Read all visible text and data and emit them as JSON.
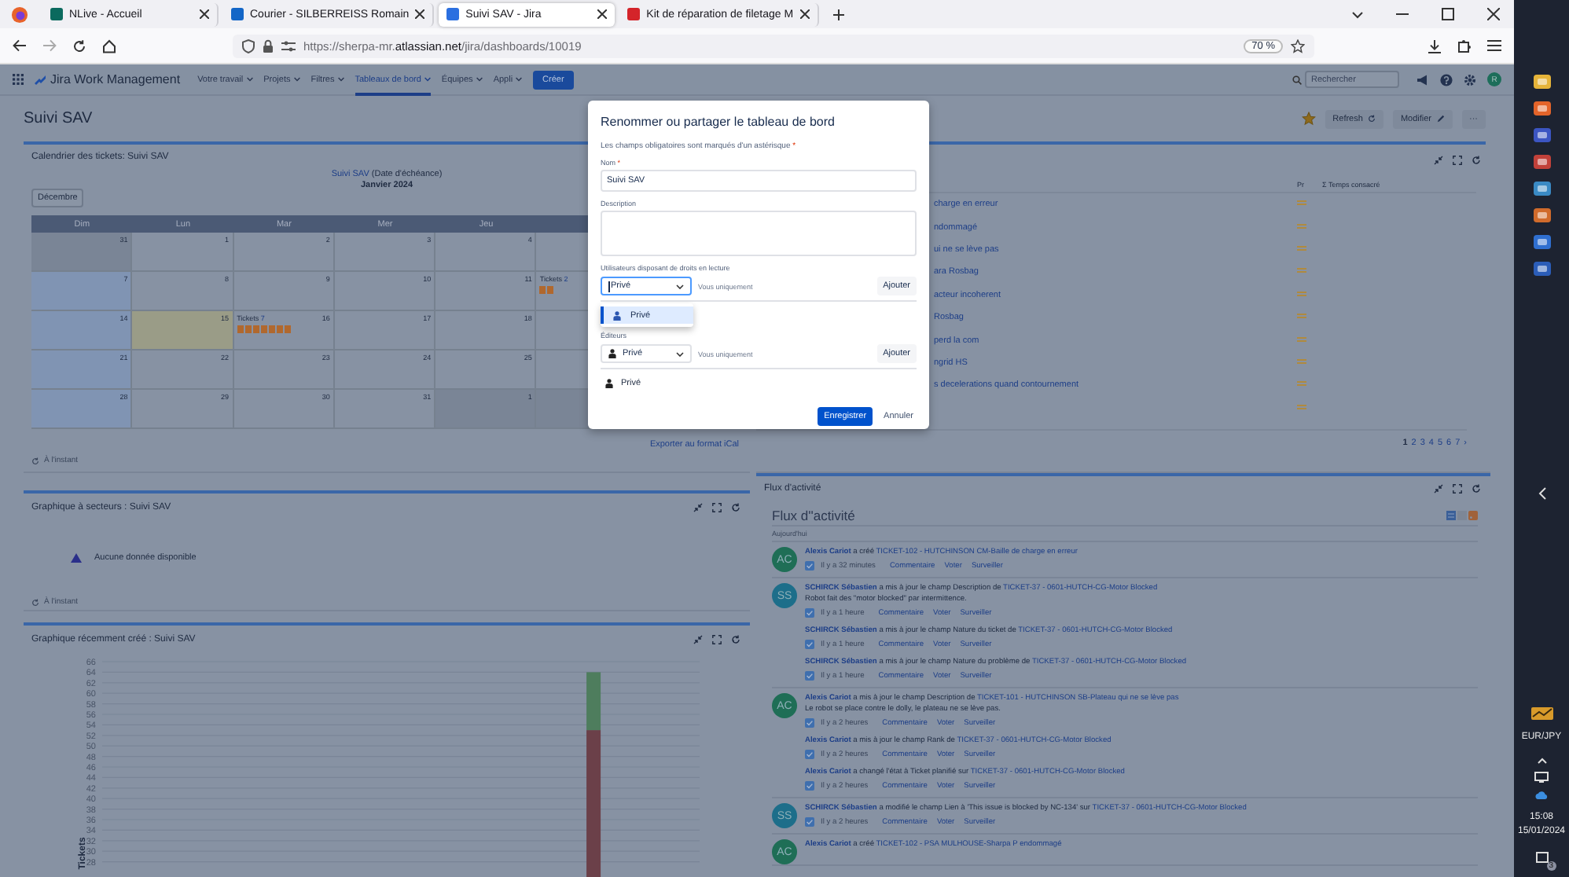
{
  "browser": {
    "tabs": [
      {
        "title": "NLive - Accueil",
        "kind": "nlive",
        "selected": false
      },
      {
        "title": "Courier - SILBERREISS Romain",
        "kind": "mail",
        "selected": false
      },
      {
        "title": "Suivi SAV - Jira",
        "kind": "jira",
        "selected": true
      },
      {
        "title": "Kit de réparation de filetage M",
        "kind": "rs",
        "selected": false
      }
    ],
    "url": "https://sherpa-mr.**atlassian.net**/jira/dashboards/10019",
    "zoom": "70 %"
  },
  "jira": {
    "product": "Jira Work Management",
    "nav": [
      {
        "label": "Votre travail",
        "selected": false
      },
      {
        "label": "Projets",
        "selected": false
      },
      {
        "label": "Filtres",
        "selected": false
      },
      {
        "label": "Tableaux de bord",
        "selected": true
      },
      {
        "label": "Équipes",
        "selected": false
      },
      {
        "label": "Appli",
        "selected": false
      }
    ],
    "create": "Créer",
    "search": {
      "placeholder": "Rechercher"
    },
    "avatar": "R"
  },
  "dashboard": {
    "title": "Suivi SAV",
    "starred": true,
    "refresh": "Refresh",
    "edit": "Modifier",
    "more": "···"
  },
  "calendar": {
    "title": "Calendrier des tickets: Suivi SAV",
    "filter": "Suivi SAV",
    "field": "(Date d'échéance)",
    "month": "Janvier 2024",
    "previous": "Décembre",
    "weekdays": [
      "Dim",
      "Lun",
      "Mar",
      "Mer",
      "Jeu"
    ],
    "weeks": [
      {
        "days": [
          {
            "day": "31",
            "kind": "other"
          },
          {
            "day": "1",
            "kind": "normal"
          },
          {
            "day": "2",
            "kind": "normal"
          },
          {
            "day": "3",
            "kind": "normal"
          },
          {
            "day": "4",
            "kind": "normal"
          },
          {
            "kind": "normal"
          }
        ]
      },
      {
        "days": [
          {
            "day": "7",
            "kind": "weekend"
          },
          {
            "day": "8",
            "kind": "normal"
          },
          {
            "day": "9",
            "kind": "normal"
          },
          {
            "day": "10",
            "kind": "normal"
          },
          {
            "day": "11",
            "kind": "normal"
          },
          {
            "kind": "normal",
            "tickets": {
              "label": "Tickets",
              "count": "2"
            }
          }
        ]
      },
      {
        "days": [
          {
            "day": "14",
            "kind": "weekend"
          },
          {
            "day": "15",
            "kind": "today"
          },
          {
            "day": "16",
            "kind": "normal",
            "tickets": {
              "label": "Tickets",
              "count": "7"
            }
          },
          {
            "day": "17",
            "kind": "normal"
          },
          {
            "day": "18",
            "kind": "normal"
          },
          {
            "kind": "normal"
          }
        ]
      },
      {
        "days": [
          {
            "day": "21",
            "kind": "weekend"
          },
          {
            "day": "22",
            "kind": "normal"
          },
          {
            "day": "23",
            "kind": "normal"
          },
          {
            "day": "24",
            "kind": "normal"
          },
          {
            "day": "25",
            "kind": "normal"
          },
          {
            "kind": "normal"
          }
        ]
      },
      {
        "days": [
          {
            "day": "28",
            "kind": "weekend"
          },
          {
            "day": "29",
            "kind": "normal"
          },
          {
            "day": "30",
            "kind": "normal"
          },
          {
            "day": "31",
            "kind": "normal"
          },
          {
            "day": "1",
            "kind": "other"
          },
          {
            "kind": "other"
          }
        ]
      }
    ],
    "export": "Exporter au format iCal",
    "updated": "À l'instant"
  },
  "pie": {
    "title": "Graphique à secteurs : Suivi SAV",
    "message": "Aucune donnée disponible",
    "updated": "À l'instant"
  },
  "created_chart": {
    "title": "Graphique récemment créé : Suivi SAV",
    "chart_data": {
      "type": "bar",
      "ylabel": "Tickets",
      "stacked": true,
      "grid": true,
      "ylim": [
        0,
        66
      ],
      "yticks": [
        28,
        30,
        32,
        34,
        36,
        38,
        40,
        42,
        44,
        46,
        48,
        50,
        52,
        54,
        56,
        58,
        60,
        62,
        64,
        66
      ],
      "series": [
        {
          "color": "#6b4049",
          "values": [
            0,
            0,
            0,
            0,
            0,
            0,
            0,
            0,
            0,
            0,
            0,
            0,
            0,
            0,
            0,
            0,
            0,
            0,
            0,
            0,
            0,
            0,
            0,
            0,
            0,
            53,
            0,
            0,
            0,
            0,
            0
          ]
        },
        {
          "color": "#4e7d5d",
          "values": [
            0,
            0,
            0,
            0,
            0,
            0,
            0,
            0,
            0,
            0,
            0,
            0,
            0,
            0,
            0,
            0,
            0,
            0,
            0,
            0,
            0,
            0,
            0,
            0,
            0,
            11,
            0,
            0,
            0,
            0,
            0
          ]
        }
      ]
    }
  },
  "issues": {
    "columns": [
      "Pr",
      "Σ Temps consacré"
    ],
    "rows": [
      {
        "summary": "charge en erreur",
        "kind": "medium"
      },
      {
        "summary": "ndommagé",
        "kind": "medium"
      },
      {
        "summary": "ui ne se lève pas",
        "kind": "medium"
      },
      {
        "summary": "ara Rosbag",
        "kind": "medium"
      },
      {
        "summary": "acteur incoherent",
        "kind": "medium"
      },
      {
        "summary": "Rosbag",
        "kind": "medium"
      },
      {
        "summary": "perd la com",
        "kind": "medium"
      },
      {
        "summary": "ngrid HS",
        "kind": "medium"
      },
      {
        "summary": "s decelerations quand contournement",
        "kind": "medium"
      },
      {
        "kind": "medium"
      }
    ],
    "pages": [
      {
        "label": "1",
        "selected": true
      },
      {
        "label": "2",
        "selected": false
      },
      {
        "label": "3",
        "selected": false
      },
      {
        "label": "4",
        "selected": false
      },
      {
        "label": "5",
        "selected": false
      },
      {
        "label": "6",
        "selected": false
      },
      {
        "label": "7",
        "selected": false
      }
    ],
    "next": "›"
  },
  "activity": {
    "title": "Flux d'activité",
    "heading": "Flux d''activité",
    "day": "Aujourd'hui",
    "groups": [
      {
        "initials": "AC",
        "color": "#1f6e56",
        "items": [
          {
            "author": "Alexis Cariot",
            "action": "a créé",
            "ticket": "TICKET-102 - HUTCHINSON CM-Baille de charge en erreur",
            "time": "Il y a 32 minutes",
            "actions": [
              "Commentaire",
              "Voter",
              "Surveiller"
            ]
          }
        ]
      },
      {
        "initials": "SS",
        "color": "#1d6e8a",
        "items": [
          {
            "author": "SCHIRCK Sébastien",
            "action": "a mis à jour le champ Description de",
            "ticket": "TICKET-37 - 0601-HUTCH-CG-Motor Blocked",
            "detail": "Robot fait des \"motor blocked\" par intermittence.",
            "time": "Il y a 1 heure",
            "actions": [
              "Commentaire",
              "Voter",
              "Surveiller"
            ]
          },
          {
            "author": "SCHIRCK Sébastien",
            "action": "a mis à jour le champ Nature du ticket de",
            "ticket": "TICKET-37 - 0601-HUTCH-CG-Motor Blocked",
            "time": "Il y a 1 heure",
            "actions": [
              "Commentaire",
              "Voter",
              "Surveiller"
            ]
          },
          {
            "author": "SCHIRCK Sébastien",
            "action": "a mis à jour le champ Nature du problème de",
            "ticket": "TICKET-37 - 0601-HUTCH-CG-Motor Blocked",
            "time": "Il y a 1 heure",
            "actions": [
              "Commentaire",
              "Voter",
              "Surveiller"
            ]
          }
        ]
      },
      {
        "initials": "AC",
        "color": "#1f6e56",
        "items": [
          {
            "author": "Alexis Cariot",
            "action": "a mis à jour le champ Description de",
            "ticket": "TICKET-101 - HUTCHINSON SB-Plateau qui ne se lève pas",
            "detail": "Le robot se place contre le dolly, le plateau ne se lève pas.",
            "time": "Il y a 2 heures",
            "actions": [
              "Commentaire",
              "Voter",
              "Surveiller"
            ]
          },
          {
            "author": "Alexis Cariot",
            "action": "a mis à jour le champ Rank de",
            "ticket": "TICKET-37 - 0601-HUTCH-CG-Motor Blocked",
            "time": "Il y a 2 heures",
            "actions": [
              "Commentaire",
              "Voter",
              "Surveiller"
            ]
          },
          {
            "author": "Alexis Cariot",
            "action": "a changé l'état à Ticket planifié sur",
            "ticket": "TICKET-37 - 0601-HUTCH-CG-Motor Blocked",
            "time": "Il y a 2 heures",
            "actions": [
              "Commentaire",
              "Voter",
              "Surveiller"
            ]
          }
        ]
      },
      {
        "initials": "SS",
        "color": "#1d6e8a",
        "items": [
          {
            "author": "SCHIRCK Sébastien",
            "action": "a modifié le champ Lien à 'This issue is blocked by NC-134' sur",
            "ticket": "TICKET-37 - 0601-HUTCH-CG-Motor Blocked",
            "time": "Il y a 2 heures",
            "actions": [
              "Commentaire",
              "Voter",
              "Surveiller"
            ]
          }
        ]
      },
      {
        "initials": "AC",
        "color": "#1f6e56",
        "items": [
          {
            "author": "Alexis Cariot",
            "action": "a créé",
            "ticket": "TICKET-102 - PSA MULHOUSE-Sharpa P endommagé"
          }
        ]
      }
    ]
  },
  "modal": {
    "title": "Renommer ou partager le tableau de bord",
    "note": "Les champs obligatoires sont marqués d'un astérisque",
    "required": "*",
    "name": {
      "label": "Nom",
      "required": "*",
      "value": "Suivi SAV"
    },
    "description": {
      "label": "Description"
    },
    "viewers": {
      "label": "Utilisateurs disposant de droits en lecture",
      "value": "Privé",
      "focused": true,
      "scope": "Vous uniquement",
      "add": "Ajouter",
      "options": [
        {
          "label": "Privé",
          "selected": true
        }
      ]
    },
    "editors": {
      "label": "Éditeurs",
      "value": "Privé",
      "focused": false,
      "scope": "Vous uniquement",
      "add": "Ajouter",
      "member": "Privé"
    },
    "save": "Enregistrer",
    "cancel": "Annuler"
  },
  "taskbar": {
    "widget": "EUR/JPY",
    "time": "15:08",
    "date": "15/01/2024",
    "badge": "3"
  }
}
